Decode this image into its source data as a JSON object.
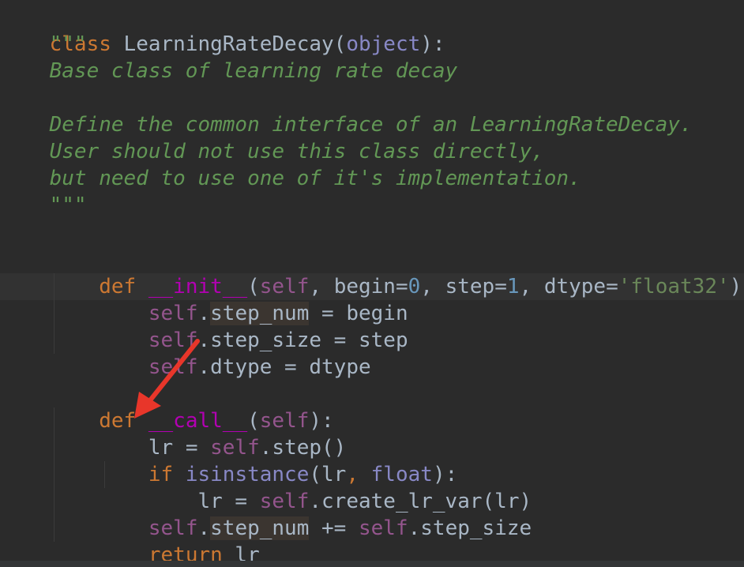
{
  "editor": {
    "lines": {
      "l1": {
        "kw": "class",
        "name": " LearningRateDecay",
        "p1": "(",
        "base": "object",
        "p2": "):"
      },
      "l2": {
        "doc": "    \"\"\""
      },
      "l3": {
        "doc": "    Base class of learning rate decay"
      },
      "l5": {
        "doc": "    Define the common interface of an LearningRateDecay."
      },
      "l6": {
        "doc": "    User should not use this class directly,"
      },
      "l7": {
        "doc": "    but need to use one of it's implementation."
      },
      "l8": {
        "doc": "    \"\"\""
      },
      "l10": {
        "indent": "    ",
        "kw": "def",
        "sp": " ",
        "fn": "__init__",
        "p1": "(",
        "self": "self",
        "c1": ", begin=",
        "n1": "0",
        "c2": ", step=",
        "n2": "1",
        "c3": ", dtype=",
        "s1": "'float32'",
        "p2": "):"
      },
      "l11": {
        "indent": "        ",
        "self": "self",
        "dot": ".",
        "attr": "step_num",
        "rest": " = begin"
      },
      "l12": {
        "indent": "        ",
        "self": "self",
        "rest": ".step_size = step"
      },
      "l13": {
        "indent": "        ",
        "self": "self",
        "rest": ".dtype = dtype"
      },
      "l15": {
        "indent": "    ",
        "kw": "def",
        "sp": " ",
        "fn": "__call__",
        "p1": "(",
        "self": "self",
        "p2": "):"
      },
      "l16": {
        "indent": "        ",
        "a": "lr = ",
        "self": "self",
        "b": ".step()"
      },
      "l17": {
        "indent": "        ",
        "kw": "if",
        "sp": " ",
        "builtin": "isinstance",
        "a": "(lr",
        "comma": ",",
        "sp2": " ",
        "builtin2": "float",
        "b": "):"
      },
      "l18": {
        "indent": "            ",
        "a": "lr = ",
        "self": "self",
        "b": ".create_lr_var(lr)"
      },
      "l19": {
        "indent": "        ",
        "self": "self",
        "dot": ".",
        "attr": "step_num",
        "a": " += ",
        "self2": "self",
        "b": ".step_size"
      },
      "l20": {
        "indent": "        ",
        "kw": "return",
        "a": " lr"
      }
    }
  },
  "colors": {
    "background": "#2b2b2b",
    "keyword": "#cc7832",
    "self": "#94558d",
    "number": "#6897bb",
    "string": "#6a8759",
    "docstring": "#629755",
    "magic_method": "#b200b2",
    "builtin": "#8888c6",
    "identifier": "#a9b7c6",
    "annotation_arrow": "#e8362a"
  }
}
